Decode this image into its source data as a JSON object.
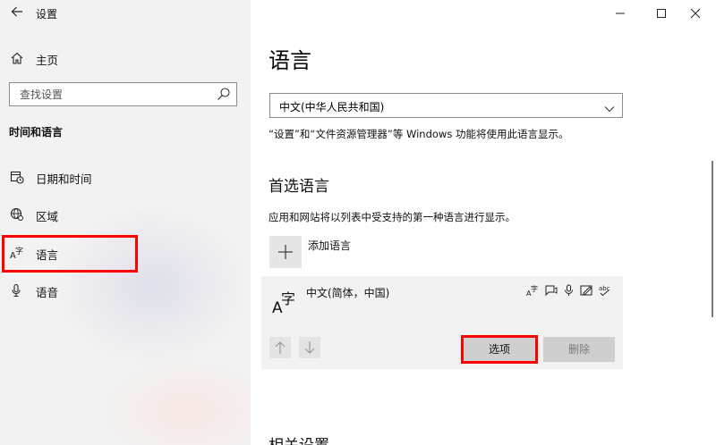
{
  "window": {
    "title": "设置"
  },
  "sidebar": {
    "home_label": "主页",
    "search_placeholder": "查找设置",
    "section_heading": "时间和语言",
    "items": [
      {
        "label": "日期和时间",
        "icon": "calendar-clock-icon"
      },
      {
        "label": "区域",
        "icon": "globe-icon"
      },
      {
        "label": "语言",
        "icon": "language-icon",
        "selected": true
      },
      {
        "label": "语音",
        "icon": "microphone-icon"
      }
    ]
  },
  "main": {
    "page_title": "语言",
    "display_language": {
      "selected": "中文(中华人民共和国)"
    },
    "display_language_note": "“设置”和“文件资源管理器”等 Windows 功能将使用此语言显示。",
    "preferred": {
      "title": "首选语言",
      "description": "应用和网站将以列表中受支持的第一种语言进行显示。",
      "add_label": "添加语言",
      "languages": [
        {
          "name": "中文(简体，中国)",
          "feature_icons": [
            "display-language-icon",
            "text-to-speech-icon",
            "speech-recognition-icon",
            "handwriting-icon",
            "spell-check-icon"
          ],
          "options_label": "选项",
          "remove_label": "删除"
        }
      ]
    },
    "related_title": "相关设置"
  },
  "colors": {
    "sidebar_bg": "#f2f2f2",
    "highlight": "#ff0000",
    "card_bg": "#f2f2f2",
    "button_bg": "#cfcfcf"
  }
}
